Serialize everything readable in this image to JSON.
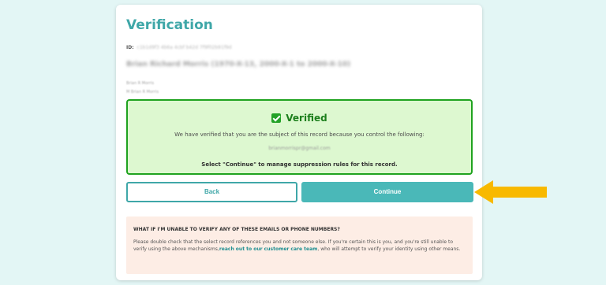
{
  "page": {
    "title": "Verification",
    "id_label": "ID:",
    "id_value": "c1b1d9f3 4b6a 4cbf b42d 7f9f02b91f9d",
    "record_title": "Brian Richard Morris (1970-X-13, 2000-X-1 to 2000-X-10)",
    "aliases": [
      "Brian R Morris",
      "M Brian R Morris"
    ]
  },
  "verified": {
    "heading": "Verified",
    "message": "We have verified that you are the subject of this record because you control the following:",
    "email": "brianmorrispr@gmail.com",
    "instruction": "Select \"Continue\" to manage suppression rules for this record."
  },
  "buttons": {
    "back_label": "Back",
    "continue_label": "Continue"
  },
  "help": {
    "heading": "WHAT IF I'M UNABLE TO VERIFY ANY OF THESE EMAILS OR PHONE NUMBERS?",
    "body_prefix": "Please double check that the select record references you and not someone else. If you're certain this is you, and you're still unable to verify using the above mechanisms,",
    "link_text": "reach out to our customer care team",
    "body_suffix": ", who will attempt to verify your identity using other means."
  },
  "colors": {
    "background": "#e3f6f5",
    "accent": "#3fa7a8",
    "success": "#1fa31f",
    "success_fill": "#ddf8d0",
    "arrow": "#f8b900",
    "help_fill": "#fdede5"
  },
  "icons": {
    "verified": "check-box-icon",
    "pointer": "arrow-left-icon"
  }
}
